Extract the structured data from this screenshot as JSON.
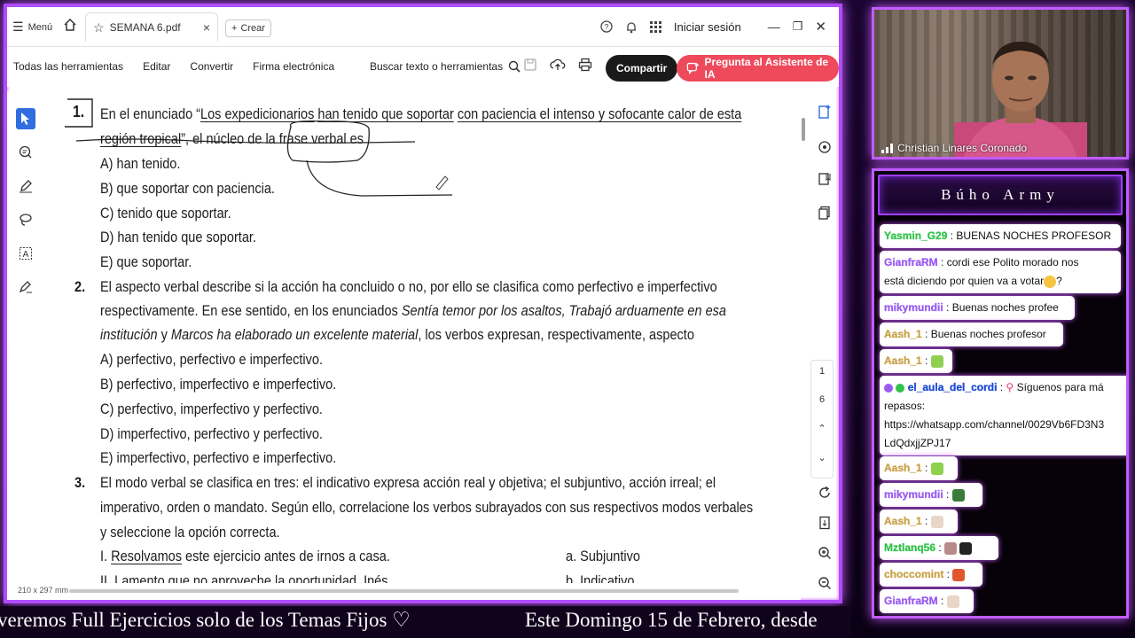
{
  "topbar": {
    "menu_label": "Menú",
    "tab_title": "SEMANA 6.pdf",
    "tab_close": "×",
    "create_label": "Crear",
    "login_label": "Iniciar sesión"
  },
  "toolbar": {
    "tools": [
      "Todas las herramientas",
      "Editar",
      "Convertir",
      "Firma electrónica"
    ],
    "search_label": "Buscar texto o herramientas",
    "share_label": "Compartir",
    "ai_label": "Pregunta al Asistente de IA"
  },
  "page_nav": {
    "current": "1",
    "total": "6"
  },
  "status": {
    "page_size": "210 x 297 mm"
  },
  "document": {
    "q1": {
      "num": "1.",
      "l1a": "En el enunciado “",
      "l1b": "Los expedicionarios",
      "l1c": " ",
      "l1d": "han tenido que soportar",
      "l1e": " ",
      "l1f": "con paciencia el intenso y sofocante calor de esta",
      "l2a": "región tropical",
      "l2b": "”, el núcleo de la frase verbal es",
      "opts": [
        "A) han tenido.",
        "B) que soportar con paciencia.",
        "C) tenido que soportar.",
        "D) han tenido que soportar.",
        "E) que soportar."
      ]
    },
    "q2": {
      "num": "2.",
      "l1": "El aspecto verbal describe si la acción ha concluido o no, por ello se clasifica como perfectivo e imperfectivo",
      "l2a": "respectivamente. En ese sentido, en los enunciados ",
      "l2b": "Sentía temor por los asaltos, Trabajó arduamente en esa",
      "l3a": "institución",
      "l3b": " y ",
      "l3c": "Marcos ha elaborado un excelente material",
      "l3d": ", los verbos expresan, respectivamente, aspecto",
      "opts": [
        "A) perfectivo, perfectivo e imperfectivo.",
        "B) perfectivo, imperfectivo e imperfectivo.",
        "C) perfectivo, imperfectivo y perfectivo.",
        "D) imperfectivo, perfectivo y perfectivo.",
        "E) imperfectivo, perfectivo e imperfectivo."
      ]
    },
    "q3": {
      "num": "3.",
      "l1": "El modo verbal se clasifica en tres: el indicativo expresa acción real y objetiva; el subjuntivo, acción irreal; el",
      "l2": "imperativo, orden o mandato. Según ello, correlacione los verbos subrayados con sus respectivos modos verbales",
      "l3": "y seleccione la opción correcta.",
      "i1a": "I. ",
      "i1b": "Resolvamos",
      "i1c": " este ejercicio antes de irnos a casa.",
      "m1": "a. Subjuntivo",
      "i2": "II. Lamento que no aproveche la oportunidad, Inés.",
      "m2": "b. Indicativo"
    }
  },
  "webcam": {
    "name": "Christian Linares Coronado"
  },
  "chat": {
    "title": "Búho Army",
    "messages": [
      {
        "user": "Yasmin_G29",
        "sep": " : ",
        "text": "BUENAS NOCHES PROFESOR"
      },
      {
        "user": "GianfraRM",
        "sep": " : ",
        "text": "cordi ese Polito morado nos",
        "text2": "está diciendo por quien va a votar",
        "text3": "?"
      },
      {
        "user": "mikymundii",
        "sep": " : ",
        "text": "Buenas noches profee"
      },
      {
        "user": "Aash_1",
        "sep": " : ",
        "text": "Buenas noches profesor"
      },
      {
        "user": "Aash_1",
        "sep": " : ",
        "text": ""
      },
      {
        "user": "el_aula_del_cordi",
        "sep": " : ",
        "text": "Síguenos para má",
        "text2": "repasos:",
        "text3": "https://whatsapp.com/channel/0029Vb6FD3N3",
        "text4": "LdQdxjjZPJ17"
      },
      {
        "user": "Aash_1",
        "sep": " : ",
        "text": ""
      },
      {
        "user": "mikymundii",
        "sep": " : ",
        "text": ""
      },
      {
        "user": "Aash_1",
        "sep": " : ",
        "text": ""
      },
      {
        "user": "Mztlanq56",
        "sep": " : ",
        "text": ""
      },
      {
        "user": "choccomint",
        "sep": " : ",
        "text": ""
      },
      {
        "user": "GianfraRM",
        "sep": " : ",
        "text": ""
      }
    ]
  },
  "ticker": {
    "left": "veremos Full Ejercicios solo de los Temas Fijos ♡",
    "right": "Este Domingo 15 de Febrero, desde"
  },
  "colors": {
    "frame_glow": "#c85bff",
    "share_bg": "#1a1a1a",
    "ai_bg": "#ee4a5c",
    "active_tool": "#2f6de0"
  }
}
